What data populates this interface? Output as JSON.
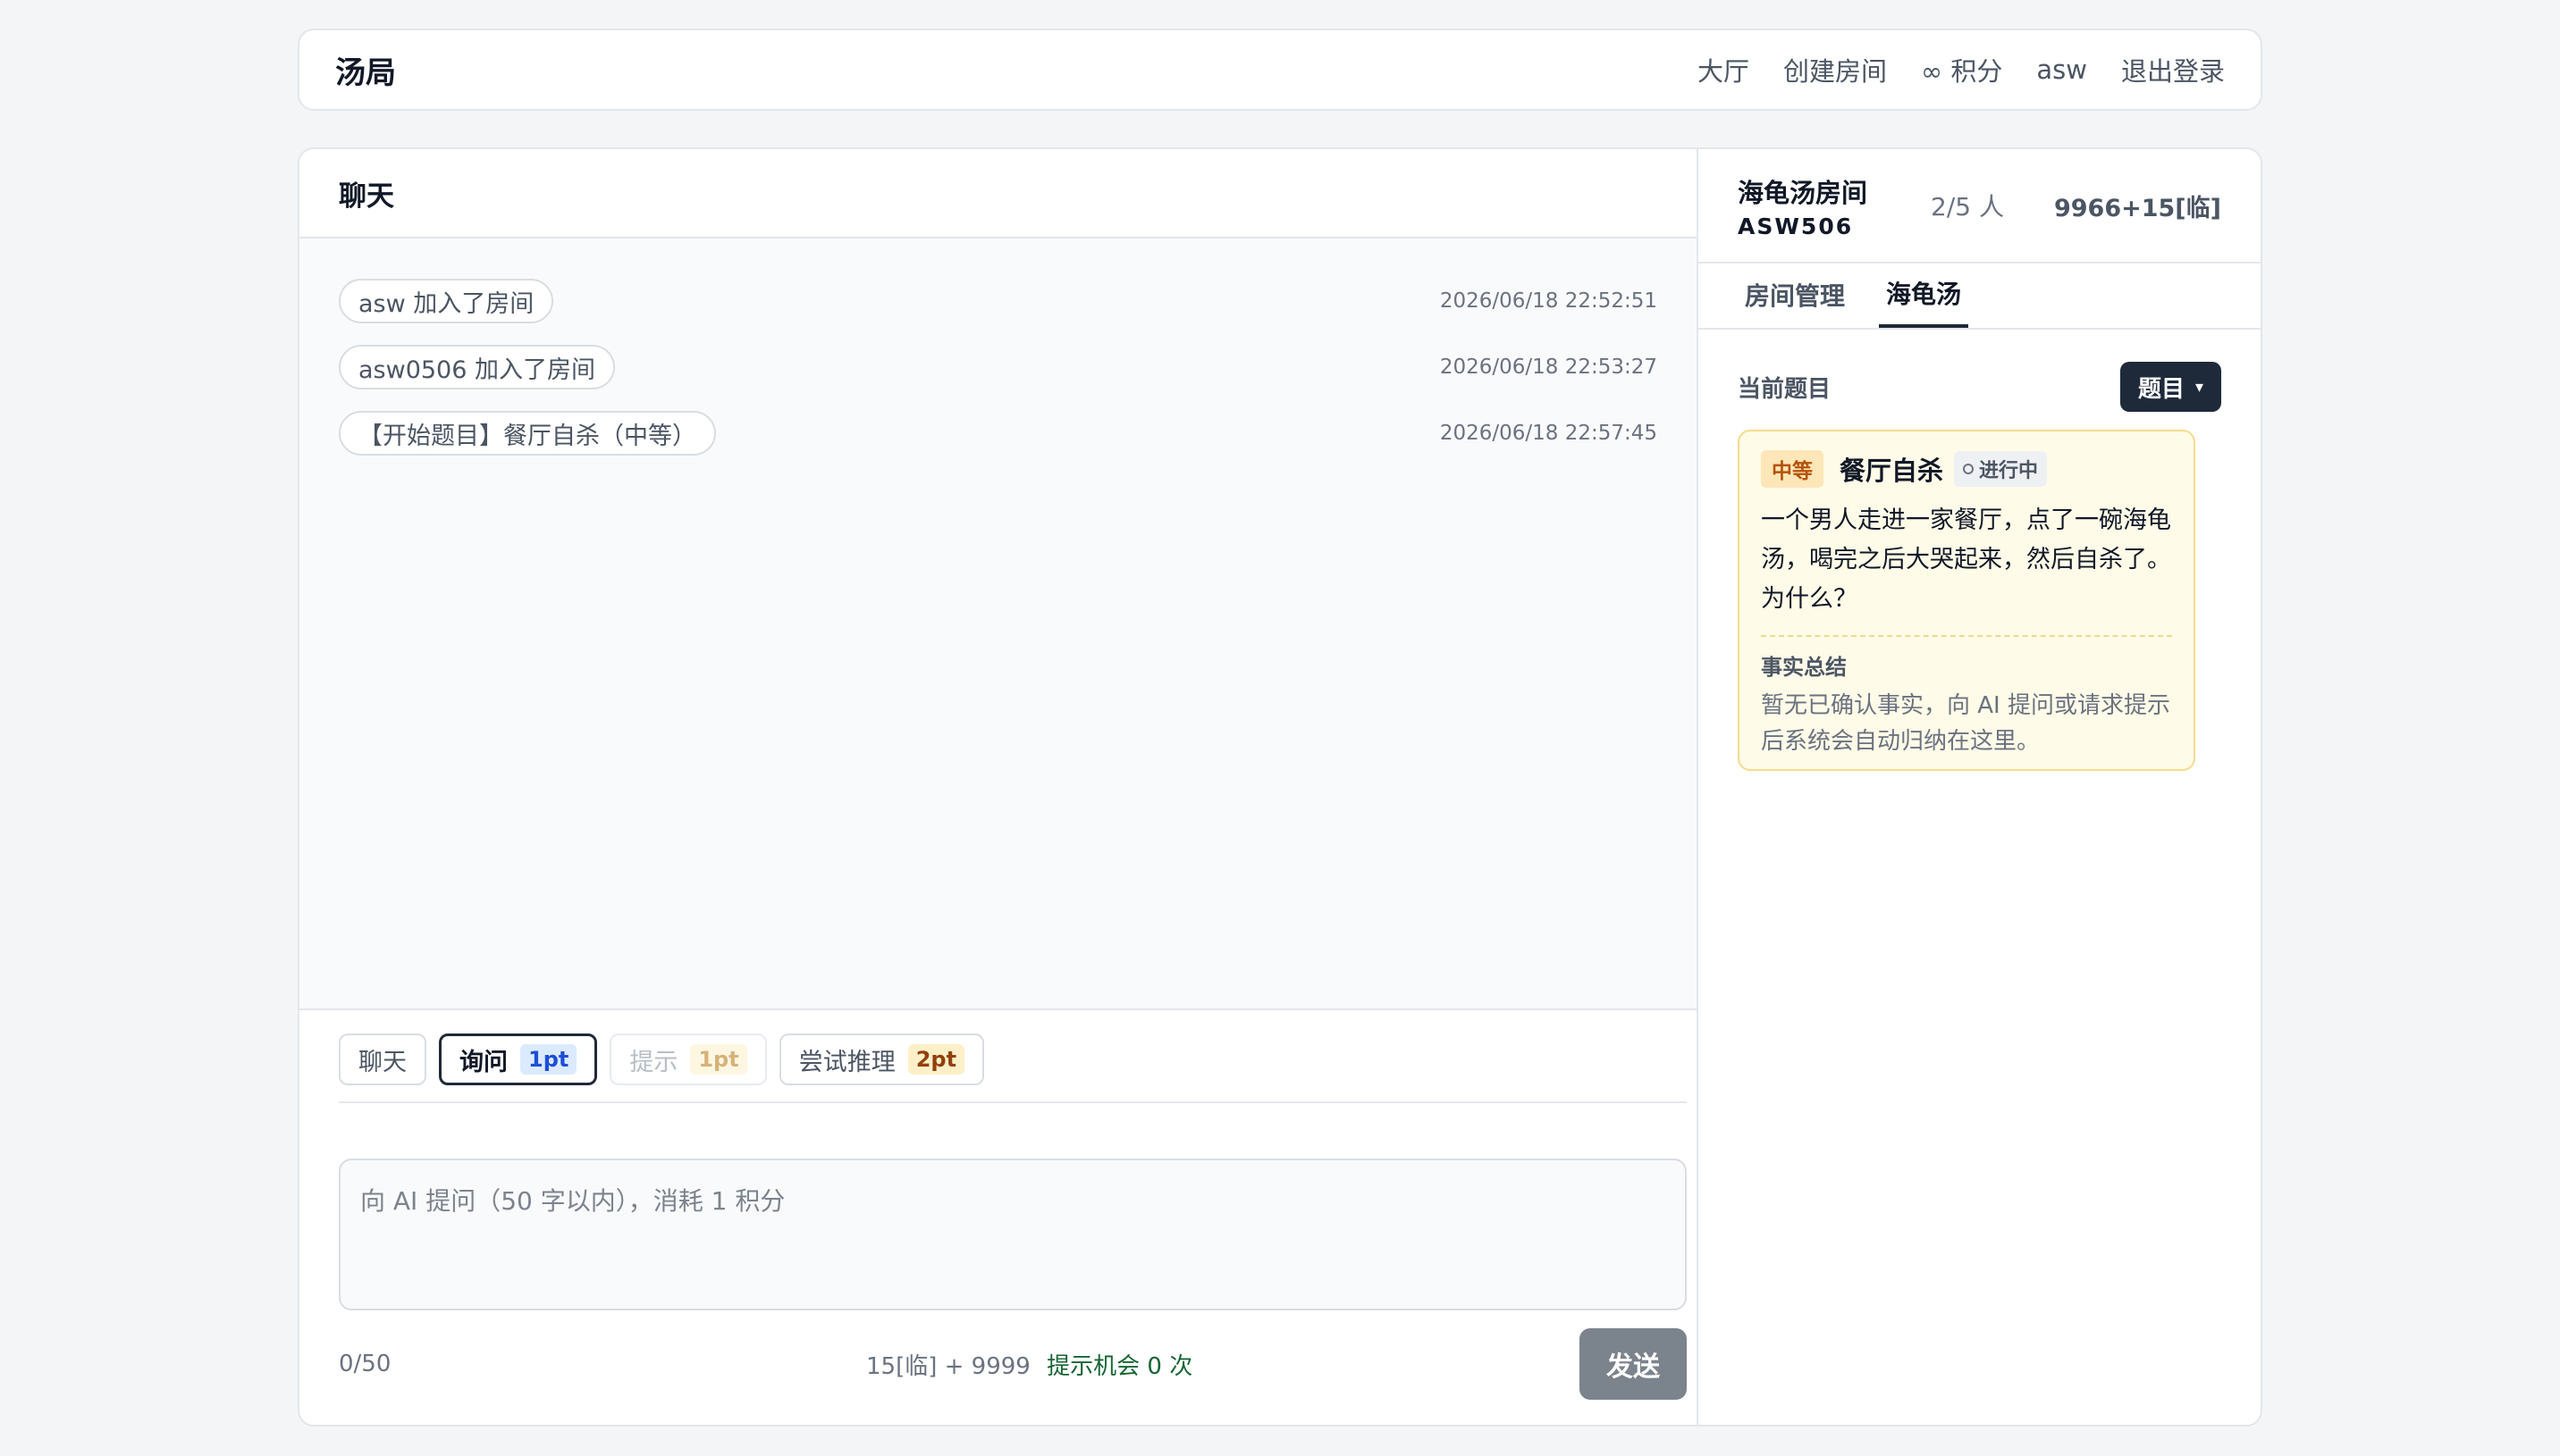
{
  "header": {
    "brand": "汤局",
    "nav": {
      "lobby": "大厅",
      "create_room": "创建房间",
      "points": "∞ 积分",
      "user": "asw",
      "logout": "退出登录"
    }
  },
  "chat": {
    "title": "聊天",
    "messages": [
      {
        "text": "asw 加入了房间",
        "time": "2026/06/18 22:52:51"
      },
      {
        "text": "asw0506 加入了房间",
        "time": "2026/06/18 22:53:27"
      },
      {
        "text": "【开始题目】餐厅自杀（中等）",
        "time": "2026/06/18 22:57:45"
      }
    ]
  },
  "composer": {
    "modes": {
      "chat": {
        "label": "聊天"
      },
      "ask": {
        "label": "询问",
        "cost": "1pt"
      },
      "hint": {
        "label": "提示",
        "cost": "1pt"
      },
      "deduce": {
        "label": "尝试推理",
        "cost": "2pt"
      }
    },
    "active_mode": "ask",
    "placeholder": "向 AI 提问（50 字以内），消耗 1 积分",
    "value": "",
    "counter": "0/50",
    "balance": "15[临] + 9999",
    "hint_chance": "提示机会 0 次",
    "send_label": "发送"
  },
  "room": {
    "name": "海龟汤房间",
    "code": "ASW506",
    "people": "2/5 人",
    "points": "9966+15[临]",
    "tabs": {
      "manage": "房间管理",
      "soup": "海龟汤"
    },
    "active_tab": "soup"
  },
  "puzzle": {
    "label": "当前题目",
    "topic_button": "题目",
    "difficulty": "中等",
    "title": "餐厅自杀",
    "status": "进行中",
    "text": "一个男人走进一家餐厅，点了一碗海龟汤，喝完之后大哭起来，然后自杀了。为什么？",
    "facts_title": "事实总结",
    "facts_text": "暂无已确认事实，向 AI 提问或请求提示后系统会自动归纳在这里。"
  },
  "colors": {
    "primary_dark": "#1e2a3a",
    "card_bg": "#fefbe8",
    "card_border": "#f4dc8a",
    "cost_blue": "#1d4ed8",
    "cost_amber": "#92400e",
    "hint_green": "#166534",
    "send_disabled": "#7b838d"
  },
  "icons": {
    "topic_caret": "caret-down-icon",
    "status": "circle-outline-icon"
  }
}
